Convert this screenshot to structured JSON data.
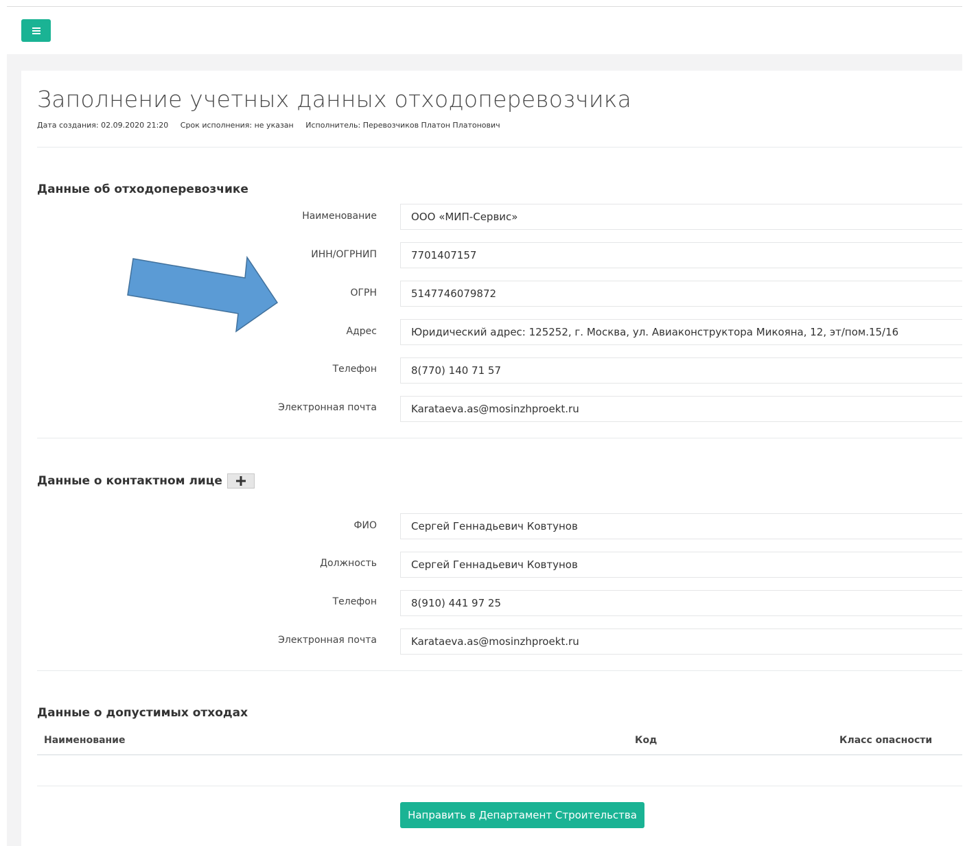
{
  "header": {
    "menu_icon": "hamburger-icon"
  },
  "page": {
    "title": "Заполнение учетных данных отходоперевозчика",
    "meta": {
      "created": "Дата создания: 02.09.2020 21:20",
      "deadline": "Срок исполнения: не указан",
      "executor": "Исполнитель: Перевозчиков Платон Платонович"
    }
  },
  "carrier": {
    "title": "Данные об отходоперевозчике",
    "fields": {
      "name": {
        "label": "Наименование",
        "value": "ООО «МИП-Сервис»"
      },
      "inn": {
        "label": "ИНН/ОГРНИП",
        "value": "7701407157"
      },
      "ogrn": {
        "label": "ОГРН",
        "value": "5147746079872"
      },
      "address": {
        "label": "Адрес",
        "value": "Юридический адрес: 125252, г. Москва, ул. Авиаконструктора Микояна, 12, эт/пом.15/16"
      },
      "phone": {
        "label": "Телефон",
        "value": "8(770) 140 71 57"
      },
      "email": {
        "label": "Электронная почта",
        "value": "Karataeva.as@mosinzhproekt.ru"
      }
    }
  },
  "contact": {
    "title": "Данные о контактном лице",
    "add_icon": "plus-icon",
    "fields": {
      "fio": {
        "label": "ФИО",
        "value": "Сергей Геннадьевич Ковтунов"
      },
      "position": {
        "label": "Должность",
        "value": "Сергей Геннадьевич Ковтунов"
      },
      "phone": {
        "label": "Телефон",
        "value": "8(910) 441 97 25"
      },
      "email": {
        "label": "Электронная почта",
        "value": "Karataeva.as@mosinzhproekt.ru"
      }
    }
  },
  "waste": {
    "title": "Данные о допустимых отходах",
    "columns": [
      "Наименование",
      "Код",
      "Класс опасности"
    ],
    "rows": []
  },
  "actions": {
    "submit_label": "Направить в Департамент Строительства"
  },
  "colors": {
    "accent": "#1ab394",
    "arrow_fill": "#5b9bd5",
    "arrow_stroke": "#41719c"
  }
}
